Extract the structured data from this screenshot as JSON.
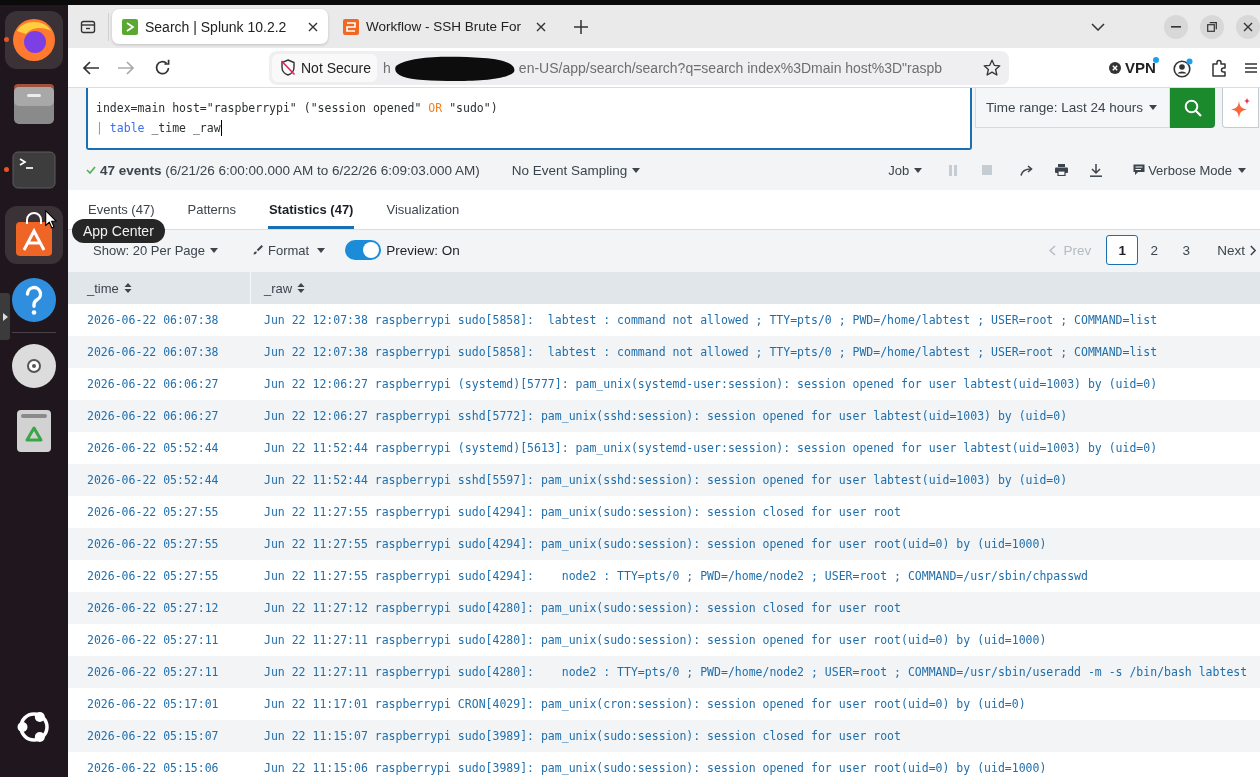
{
  "dock": {
    "apps": [
      {
        "kind": "browser",
        "running": true,
        "highlighted": true
      },
      {
        "kind": "files",
        "running": false,
        "highlighted": false
      },
      {
        "kind": "terminal",
        "running": true,
        "highlighted": false
      },
      {
        "kind": "app_center",
        "running": false,
        "highlighted": true
      },
      {
        "kind": "help",
        "running": false,
        "highlighted": false
      }
    ],
    "devices": [
      {
        "kind": "disc",
        "running": false,
        "highlighted": false
      },
      {
        "kind": "trash",
        "running": false,
        "highlighted": false
      }
    ],
    "tooltip": "App Center"
  },
  "browser": {
    "tabs": [
      {
        "kind": "splunk",
        "title": "Search | Splunk 10.2.2",
        "selected": true
      },
      {
        "kind": "workflow",
        "title": "Workflow - SSH Brute For",
        "selected": false
      }
    ],
    "nav": [
      {
        "kind": "back",
        "disabled": false
      },
      {
        "kind": "forward",
        "disabled": true
      },
      {
        "kind": "reload",
        "disabled": false
      }
    ],
    "security_label": "Not Secure",
    "url_start": "h",
    "url_rest": "en-US/app/search/search?q=search index%3Dmain host%3D\"raspb",
    "vpn_label": "VPN"
  },
  "search": {
    "query_lines": [
      [
        {
          "text": "index=main host=\"raspberrypi\" (\"session opened\" ",
          "kind": "plain"
        },
        {
          "text": "OR",
          "kind": "operator"
        },
        {
          "text": " \"sudo\")",
          "kind": "plain"
        }
      ],
      [
        {
          "text": "| ",
          "kind": "pipe"
        },
        {
          "text": "table",
          "kind": "command"
        },
        {
          "text": " _time _raw",
          "kind": "plain"
        }
      ]
    ],
    "time_range": "Time range: Last 24 hours"
  },
  "status": {
    "summary": "**47 events** (6/21/26 6:00:00.000 AM to 6/22/26 6:09:03.000 AM)",
    "sampling": "No Event Sampling",
    "job": "Job",
    "job_controls": [
      {
        "kind": "pause",
        "disabled": true
      },
      {
        "kind": "stop",
        "disabled": true
      },
      {
        "kind": "share",
        "disabled": false
      },
      {
        "kind": "print",
        "disabled": false
      },
      {
        "kind": "export",
        "disabled": false
      }
    ],
    "mode": "Verbose Mode"
  },
  "result_tabs": [
    {
      "label": "Events (47)",
      "selected": false
    },
    {
      "label": "Patterns",
      "selected": false
    },
    {
      "label": "Statistics (47)",
      "selected": true
    },
    {
      "label": "Visualization",
      "selected": false
    }
  ],
  "results_toolbar": {
    "page_size": "Show: 20 Per Page",
    "format": "Format",
    "preview": {
      "label": "Preview: On",
      "on": true
    },
    "prev": {
      "label": "Prev",
      "disabled": true
    },
    "pages": [
      {
        "label": "1",
        "selected": true
      },
      {
        "label": "2",
        "selected": false
      },
      {
        "label": "3",
        "selected": false
      }
    ],
    "next": {
      "label": "Next",
      "disabled": false
    }
  },
  "table": {
    "columns": [
      {
        "label": "_time"
      },
      {
        "label": "_raw"
      }
    ],
    "rows": [
      [
        "2026-06-22 06:07:38",
        "Jun 22 12:07:38 raspberrypi sudo[5858]:  labtest : command not allowed ; TTY=pts/0 ; PWD=/home/labtest ; USER=root ; COMMAND=list"
      ],
      [
        "2026-06-22 06:07:38",
        "Jun 22 12:07:38 raspberrypi sudo[5858]:  labtest : command not allowed ; TTY=pts/0 ; PWD=/home/labtest ; USER=root ; COMMAND=list"
      ],
      [
        "2026-06-22 06:06:27",
        "Jun 22 12:06:27 raspberrypi (systemd)[5777]: pam_unix(systemd-user:session): session opened for user labtest(uid=1003) by (uid=0)"
      ],
      [
        "2026-06-22 06:06:27",
        "Jun 22 12:06:27 raspberrypi sshd[5772]: pam_unix(sshd:session): session opened for user labtest(uid=1003) by (uid=0)"
      ],
      [
        "2026-06-22 05:52:44",
        "Jun 22 11:52:44 raspberrypi (systemd)[5613]: pam_unix(systemd-user:session): session opened for user labtest(uid=1003) by (uid=0)"
      ],
      [
        "2026-06-22 05:52:44",
        "Jun 22 11:52:44 raspberrypi sshd[5597]: pam_unix(sshd:session): session opened for user labtest(uid=1003) by (uid=0)"
      ],
      [
        "2026-06-22 05:27:55",
        "Jun 22 11:27:55 raspberrypi sudo[4294]: pam_unix(sudo:session): session closed for user root"
      ],
      [
        "2026-06-22 05:27:55",
        "Jun 22 11:27:55 raspberrypi sudo[4294]: pam_unix(sudo:session): session opened for user root(uid=0) by (uid=1000)"
      ],
      [
        "2026-06-22 05:27:55",
        "Jun 22 11:27:55 raspberrypi sudo[4294]:    node2 : TTY=pts/0 ; PWD=/home/node2 ; USER=root ; COMMAND=/usr/sbin/chpasswd"
      ],
      [
        "2026-06-22 05:27:12",
        "Jun 22 11:27:12 raspberrypi sudo[4280]: pam_unix(sudo:session): session closed for user root"
      ],
      [
        "2026-06-22 05:27:11",
        "Jun 22 11:27:11 raspberrypi sudo[4280]: pam_unix(sudo:session): session opened for user root(uid=0) by (uid=1000)"
      ],
      [
        "2026-06-22 05:27:11",
        "Jun 22 11:27:11 raspberrypi sudo[4280]:    node2 : TTY=pts/0 ; PWD=/home/node2 ; USER=root ; COMMAND=/usr/sbin/useradd -m -s /bin/bash labtest"
      ],
      [
        "2026-06-22 05:17:01",
        "Jun 22 11:17:01 raspberrypi CRON[4029]: pam_unix(cron:session): session opened for user root(uid=0) by (uid=0)"
      ],
      [
        "2026-06-22 05:15:07",
        "Jun 22 11:15:07 raspberrypi sudo[3989]: pam_unix(sudo:session): session closed for user root"
      ],
      [
        "2026-06-22 05:15:06",
        "Jun 22 11:15:06 raspberrypi sudo[3989]: pam_unix(sudo:session): session opened for user root(uid=0) by (uid=1000)"
      ]
    ]
  }
}
